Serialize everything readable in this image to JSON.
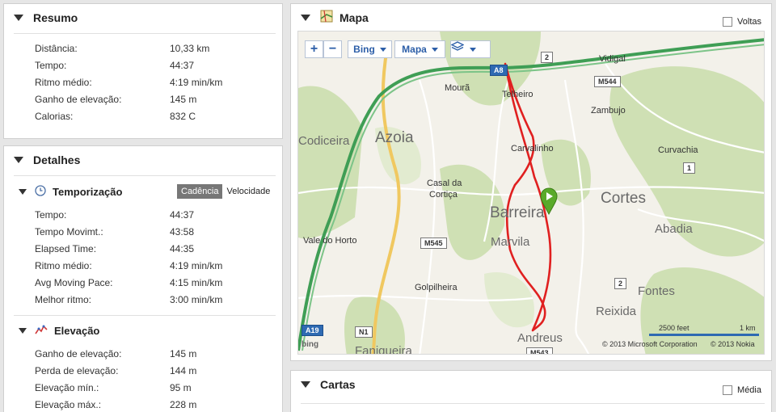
{
  "summary": {
    "title": "Resumo",
    "rows": [
      {
        "label": "Distância:",
        "value": "10,33 km"
      },
      {
        "label": "Tempo:",
        "value": "44:37"
      },
      {
        "label": "Ritmo médio:",
        "value": "4:19 min/km"
      },
      {
        "label": "Ganho de elevação:",
        "value": "145 m"
      },
      {
        "label": "Calorias:",
        "value": "832 C"
      }
    ]
  },
  "details": {
    "title": "Detalhes",
    "timing": {
      "title": "Temporização",
      "toggle_on": "Cadência",
      "toggle_off": "Velocidade",
      "rows": [
        {
          "label": "Tempo:",
          "value": "44:37"
        },
        {
          "label": "Tempo Movimt.:",
          "value": "43:58"
        },
        {
          "label": "Elapsed Time:",
          "value": "44:35"
        },
        {
          "label": "Ritmo médio:",
          "value": "4:19 min/km"
        },
        {
          "label": "Avg Moving Pace:",
          "value": "4:15 min/km"
        },
        {
          "label": "Melhor ritmo:",
          "value": "3:00 min/km"
        }
      ]
    },
    "elevation": {
      "title": "Elevação",
      "rows": [
        {
          "label": "Ganho de elevação:",
          "value": "145 m"
        },
        {
          "label": "Perda de elevação:",
          "value": "144 m"
        },
        {
          "label": "Elevação mín.:",
          "value": "95 m"
        },
        {
          "label": "Elevação máx.:",
          "value": "228 m"
        }
      ]
    }
  },
  "map_panel": {
    "title": "Mapa",
    "laps_label": "Voltas",
    "controls": {
      "zoom_in": "+",
      "zoom_out": "−",
      "provider": "Bing",
      "view": "Mapa"
    },
    "places": {
      "moura": "Mourã",
      "telheiro": "Telheiro",
      "vidigal": "Vidigal",
      "zambujo": "Zambujo",
      "codiceira": "Codiceira",
      "azoia": "Azoia",
      "carvalinho": "Carvalinho",
      "curvachia": "Curvachia",
      "casal1": "Casal da",
      "casal2": "Cortiça",
      "barreira": "Barreira",
      "cortes": "Cortes",
      "abadia": "Abadia",
      "marvila": "Marvila",
      "vale_horto": "Vale do Horto",
      "golpilheira": "Golpilheira",
      "fontes": "Fontes",
      "reixida": "Reixida",
      "andreus": "Andreus",
      "faniqueira": "Faniqueira"
    },
    "roads": {
      "a8": "A8",
      "r2a": "2",
      "m544": "M544",
      "r1": "1",
      "m545": "M545",
      "r2b": "2",
      "a19": "A19",
      "n1": "N1",
      "m543": "M543"
    },
    "scale": {
      "feet": "2500 feet",
      "km": "1 km"
    },
    "attribution": {
      "microsoft": "© 2013 Microsoft Corporation",
      "nokia": "© 2013 Nokia"
    },
    "brand": "bing",
    "colors": {
      "route": "#e02020",
      "highway": "#4cab5e",
      "marker": "#5aaa2a"
    }
  },
  "charts_panel": {
    "title": "Cartas",
    "average_label": "Média"
  }
}
